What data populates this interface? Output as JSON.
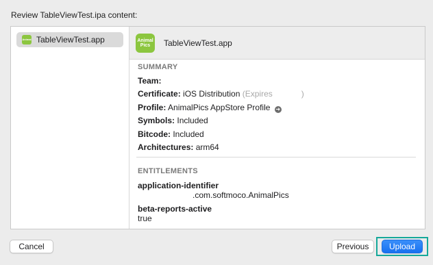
{
  "dialog": {
    "heading": "Review TableViewTest.ipa content:"
  },
  "sidebar": {
    "items": [
      {
        "label": "TableViewTest.app",
        "icon": "animal-pics-app-icon",
        "selected": true
      }
    ]
  },
  "detail": {
    "app_name": "TableViewTest.app",
    "app_icon": {
      "line1": "Animal",
      "line2": "Pics",
      "color": "#8cc63f"
    },
    "summary": {
      "title": "SUMMARY",
      "team_label": "Team:",
      "team_value": "",
      "certificate_label": "Certificate:",
      "certificate_value": "iOS Distribution",
      "certificate_note": "(Expires",
      "certificate_note_end": ")",
      "profile_label": "Profile:",
      "profile_value": "AnimalPics AppStore Profile",
      "symbols_label": "Symbols:",
      "symbols_value": "Included",
      "bitcode_label": "Bitcode:",
      "bitcode_value": "Included",
      "architectures_label": "Architectures:",
      "architectures_value": "arm64"
    },
    "entitlements": {
      "title": "ENTITLEMENTS",
      "items": [
        {
          "key": "application-identifier",
          "value": ".com.softmoco.AnimalPics"
        },
        {
          "key": "beta-reports-active",
          "value": "true"
        }
      ]
    }
  },
  "buttons": {
    "cancel": "Cancel",
    "previous": "Previous",
    "upload": "Upload"
  },
  "colors": {
    "accent": "#1871f0",
    "focus_ring": "#15a89a"
  }
}
